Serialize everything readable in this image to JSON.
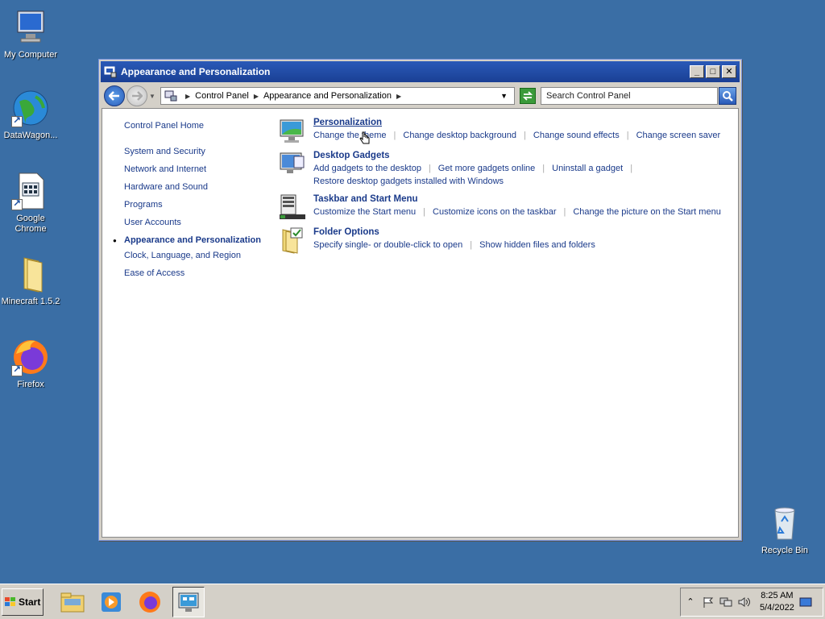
{
  "desktop": {
    "icons": [
      {
        "label": "My Computer"
      },
      {
        "label": "DataWagon..."
      },
      {
        "label": "Google Chrome"
      },
      {
        "label": "Minecraft 1.5.2"
      },
      {
        "label": "Firefox"
      },
      {
        "label": "Recycle Bin"
      }
    ]
  },
  "window": {
    "title": "Appearance and Personalization",
    "buttons": {
      "minimize": "_",
      "maximize": "□",
      "close": "✕"
    }
  },
  "address": {
    "crumbs": [
      "Control Panel",
      "Appearance and Personalization"
    ]
  },
  "search": {
    "placeholder": "Search Control Panel"
  },
  "leftnav": {
    "home": "Control Panel Home",
    "items": [
      "System and Security",
      "Network and Internet",
      "Hardware and Sound",
      "Programs",
      "User Accounts"
    ],
    "current": "Appearance and Personalization",
    "after": [
      "Clock, Language, and Region",
      "Ease of Access"
    ]
  },
  "sections": [
    {
      "title": "Personalization",
      "links": [
        "Change the theme",
        "Change desktop background",
        "Change sound effects",
        "Change screen saver"
      ]
    },
    {
      "title": "Desktop Gadgets",
      "links": [
        "Add gadgets to the desktop",
        "Get more gadgets online",
        "Uninstall a gadget",
        "Restore desktop gadgets installed with Windows"
      ]
    },
    {
      "title": "Taskbar and Start Menu",
      "links": [
        "Customize the Start menu",
        "Customize icons on the taskbar",
        "Change the picture on the Start menu"
      ]
    },
    {
      "title": "Folder Options",
      "links": [
        "Specify single- or double-click to open",
        "Show hidden files and folders"
      ]
    }
  ],
  "taskbar": {
    "start": "Start",
    "clock": {
      "time": "8:25 AM",
      "date": "5/4/2022"
    }
  }
}
